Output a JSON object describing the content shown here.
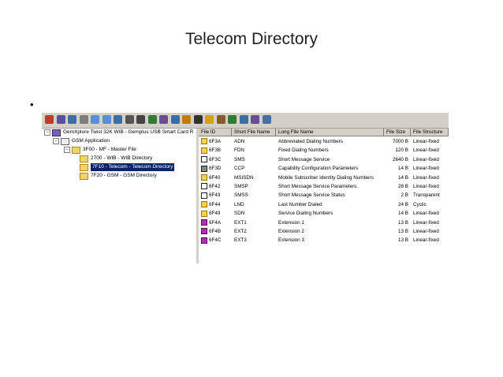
{
  "slide": {
    "title": "Telecom Directory",
    "bullet": "•"
  },
  "toolbar": {
    "icons": [
      "open-icon",
      "card-icon",
      "save-icon",
      "print-icon",
      "copy-icon",
      "paste-icon",
      "new-file-icon",
      "search-icon",
      "filter-icon",
      "pin-icon",
      "edit-icon",
      "view-icon",
      "find-icon",
      "binoculars-icon",
      "key-icon",
      "lock-icon",
      "tag-icon",
      "help-icon",
      "brush-icon",
      "settings-icon"
    ],
    "colors": [
      "#c0392b",
      "#5a4fa0",
      "#3a6ea5",
      "#7d7d7d",
      "#5b8dd9",
      "#5b8dd9",
      "#3a6ea5",
      "#555555",
      "#444444",
      "#2e7d32",
      "#6a4c93",
      "#3a6ea5",
      "#c27c0e",
      "#333333",
      "#d4a017",
      "#8b5a2b",
      "#2e7d32",
      "#3a6ea5",
      "#6a4c93",
      "#4a6fa5"
    ]
  },
  "tree": {
    "root": "GemXplore Twist 32K WIB - Gemplus USB Smart Card R",
    "gsm_app": "GSM Application",
    "mf": "3F00 - MF - Master File",
    "wib": "2700 - WIB - WIB Directory",
    "telecom": "7F10 - Telecom - Telecom Directory",
    "gsm": "7F20 - GSM - GSM Directory"
  },
  "list": {
    "headers": [
      "File ID",
      "Short File Name",
      "Long File Name",
      "File Size",
      "File Structure"
    ],
    "rows": [
      {
        "icon": "key",
        "id": "6F3A",
        "short": "ADN",
        "long": "Abbreviated Dialing Numbers",
        "size": "7000 B",
        "structure": "Linear-fixed"
      },
      {
        "icon": "key",
        "id": "6F3B",
        "short": "FDN",
        "long": "Fixed Dialing Numbers",
        "size": "120 B",
        "structure": "Linear-fixed"
      },
      {
        "icon": "sms",
        "id": "6F3C",
        "short": "SMS",
        "long": "Short Message Service",
        "size": "2640 B",
        "structure": "Linear-fixed"
      },
      {
        "icon": "bin",
        "id": "6F3D",
        "short": "CCP",
        "long": "Capability Configuration Parameters",
        "size": "14 B",
        "structure": "Linear-fixed"
      },
      {
        "icon": "key",
        "id": "6F40",
        "short": "MSISDN",
        "long": "Mobile Subscriber Identity Dialing Numbers",
        "size": "14 B",
        "structure": "Linear-fixed"
      },
      {
        "icon": "sms",
        "id": "6F42",
        "short": "SMSP",
        "long": "Short Message Service Parameters",
        "size": "28 B",
        "structure": "Linear-fixed"
      },
      {
        "icon": "sms",
        "id": "6F43",
        "short": "SMSS",
        "long": "Short Message Service Status",
        "size": "2 B",
        "structure": "Transparent"
      },
      {
        "icon": "key",
        "id": "6F44",
        "short": "LND",
        "long": "Last Number Dialed",
        "size": "24 B",
        "structure": "Cyclic"
      },
      {
        "icon": "sdn",
        "id": "6F49",
        "short": "SDN",
        "long": "Service Dialing Numbers",
        "size": "14 B",
        "structure": "Linear-fixed"
      },
      {
        "icon": "ext",
        "id": "6F4A",
        "short": "EXT1",
        "long": "Extension 1",
        "size": "13 B",
        "structure": "Linear-fixed"
      },
      {
        "icon": "ext",
        "id": "6F4B",
        "short": "EXT2",
        "long": "Extension 2",
        "size": "13 B",
        "structure": "Linear-fixed"
      },
      {
        "icon": "ext",
        "id": "6F4C",
        "short": "EXT3",
        "long": "Extension 3",
        "size": "13 B",
        "structure": "Linear-fixed"
      }
    ]
  }
}
